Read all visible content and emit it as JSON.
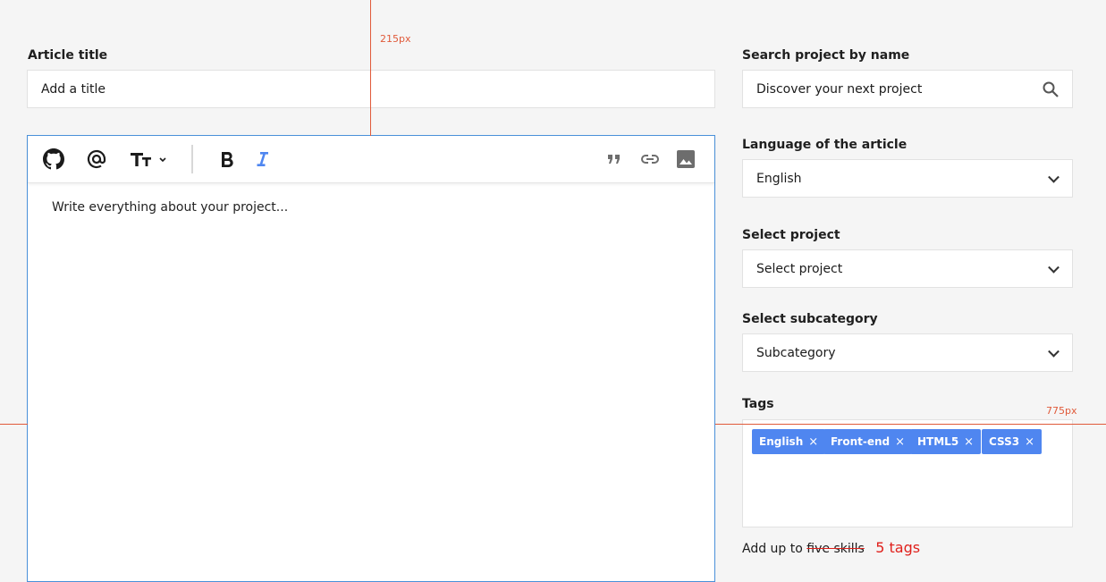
{
  "article": {
    "title_label": "Article title",
    "title_placeholder": "Add a title"
  },
  "editor": {
    "placeholder": "Write everything about your project...",
    "toolbar": {
      "github": "github-icon",
      "mention": "at-icon",
      "text_size": "text-size-icon",
      "bold": "bold-icon",
      "italic": "italic-icon",
      "quote": "quote-icon",
      "link": "link-icon",
      "image": "image-icon"
    }
  },
  "sidebar": {
    "search_label": "Search project by name",
    "search_placeholder": "Discover your next project",
    "language_label": "Language of the article",
    "language_value": "English",
    "project_label": "Select project",
    "project_value": "Select project",
    "subcategory_label": "Select subcategory",
    "subcategory_value": "Subcategory",
    "tags_label": "Tags",
    "tags": [
      "English",
      "Front-end",
      "HTML5",
      "CSS3"
    ],
    "tag_remove": "×",
    "hint_prefix": "Add up to",
    "hint_struck": "five skills",
    "hint_correction": "5 tags"
  },
  "annotations": {
    "top_guide": "215px",
    "right_guide": "775px"
  },
  "colors": {
    "accent": "#4f86f0",
    "editor_border": "#4a90d9",
    "annotation": "#e05a3a",
    "correction": "#e0201b"
  }
}
